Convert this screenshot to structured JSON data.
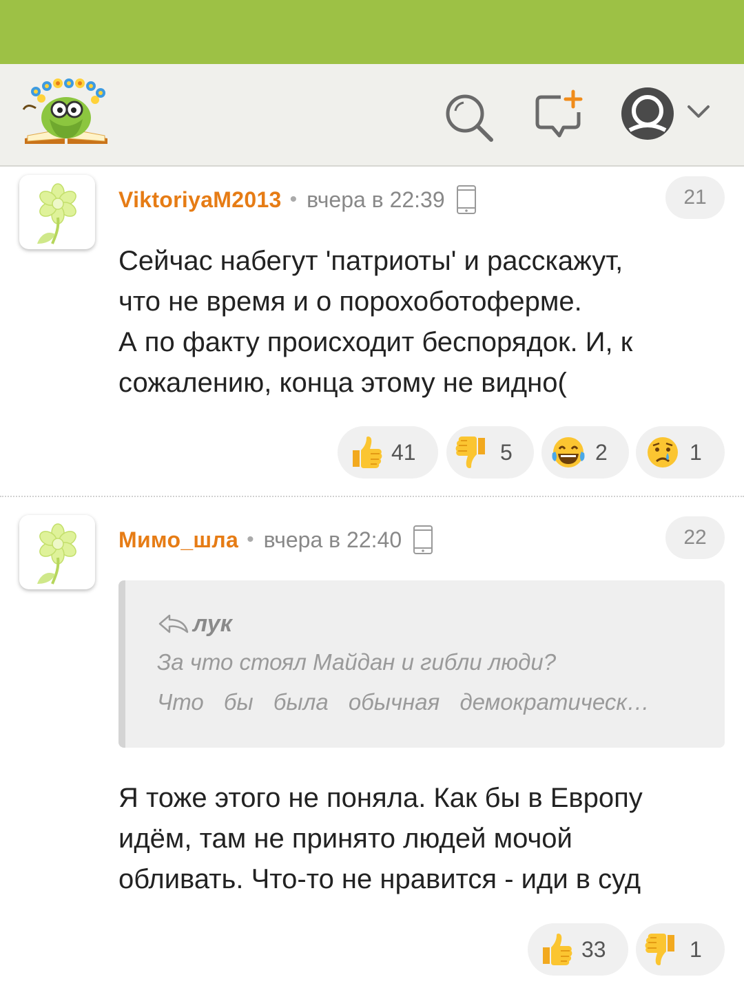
{
  "colors": {
    "status_bar": "#9dc145",
    "header_bg": "#f0f0ec",
    "username": "#e67c15",
    "muted": "#888888"
  },
  "header": {
    "logo": "site-mascot-logo",
    "icons": [
      "search-icon",
      "new-comment-icon",
      "user-avatar-icon",
      "chevron-down-icon"
    ]
  },
  "comments": [
    {
      "avatar": "flower-avatar-icon",
      "username": "ViktoriyaM2013",
      "separator": "•",
      "time": "вчера в 22:39",
      "device": "mobile-phone-icon",
      "number": "21",
      "text_lines": [
        "Сейчас набегут 'патриоты' и расскажут,",
        "что не время и о порохоботоферме.",
        "А по факту происходит беспорядок. И, к",
        "сожалению, конца этому не видно("
      ],
      "reactions": [
        {
          "icon": "thumbs-up-icon",
          "count": "41"
        },
        {
          "icon": "thumbs-down-icon",
          "count": "5"
        },
        {
          "icon": "laughing-face-icon",
          "count": "2"
        },
        {
          "icon": "crying-face-icon",
          "count": "1"
        }
      ]
    },
    {
      "avatar": "flower-avatar-icon",
      "username": "Мимо_шла",
      "separator": "•",
      "time": "вчера в 22:40",
      "device": "mobile-phone-icon",
      "number": "22",
      "quote": {
        "author": "лук",
        "line1": "За что стоял Майдан и гибли люди?",
        "line2": "Что бы была обычная демократическ…"
      },
      "text_lines": [
        "Я тоже этого не поняла. Как бы в Европу",
        "идём, там не принято людей мочой",
        "обливать. Что-то не нравится - иди в суд"
      ],
      "reactions": [
        {
          "icon": "thumbs-up-icon",
          "count": "33"
        },
        {
          "icon": "thumbs-down-icon",
          "count": "1"
        }
      ]
    }
  ]
}
